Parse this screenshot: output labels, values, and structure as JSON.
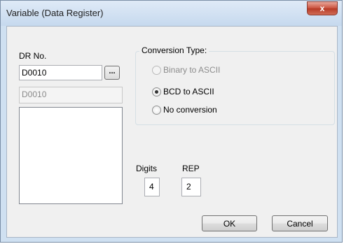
{
  "window": {
    "title": "Variable (Data Register)",
    "close_glyph": "x"
  },
  "dr": {
    "label": "DR No.",
    "value": "D0010",
    "browse_label": "...",
    "readonly_value": "D0010"
  },
  "conversion": {
    "legend": "Conversion Type:",
    "options": [
      {
        "label": "Binary to ASCII",
        "checked": false,
        "enabled": false
      },
      {
        "label": "BCD to ASCII",
        "checked": true,
        "enabled": true
      },
      {
        "label": "No conversion",
        "checked": false,
        "enabled": true
      }
    ]
  },
  "digits": {
    "label": "Digits",
    "value": "4"
  },
  "rep": {
    "label": "REP",
    "value": "2"
  },
  "buttons": {
    "ok": "OK",
    "cancel": "Cancel"
  },
  "icons": {
    "close": "close-icon",
    "browse": "ellipsis-icon"
  }
}
